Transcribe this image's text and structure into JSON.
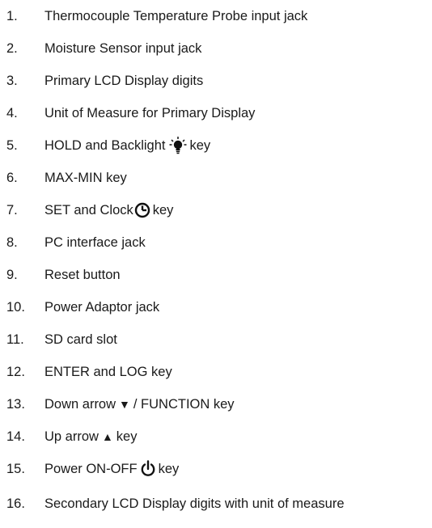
{
  "items": [
    {
      "num": "1.",
      "text": "Thermocouple Temperature Probe input jack"
    },
    {
      "num": "2.",
      "text": "Moisture Sensor input jack"
    },
    {
      "num": "3.",
      "text": "Primary LCD Display digits"
    },
    {
      "num": "4.",
      "text": "Unit of Measure for Primary Display"
    },
    {
      "num": "5.",
      "before": "HOLD and Backlight",
      "icon": "light-bulb-icon",
      "after": "key"
    },
    {
      "num": "6.",
      "text": "MAX-MIN key"
    },
    {
      "num": "7.",
      "before": "SET and Clock",
      "icon": "clock-icon",
      "after": "key"
    },
    {
      "num": "8.",
      "text": "PC interface jack"
    },
    {
      "num": "9.",
      "text": "Reset button"
    },
    {
      "num": "10.",
      "text": "Power Adaptor jack"
    },
    {
      "num": "11.",
      "text": "SD card slot"
    },
    {
      "num": "12.",
      "text": "ENTER and LOG key"
    },
    {
      "num": "13.",
      "before": "Down arrow",
      "glyph": "▼",
      "after": "/ FUNCTION key"
    },
    {
      "num": "14.",
      "before": "Up arrow",
      "glyph": "▲",
      "after": "key"
    },
    {
      "num": "15.",
      "before": "Power ON-OFF",
      "icon": "power-icon",
      "after": "key"
    },
    {
      "num": "16.",
      "text": "Secondary LCD Display digits with unit of measure"
    }
  ]
}
